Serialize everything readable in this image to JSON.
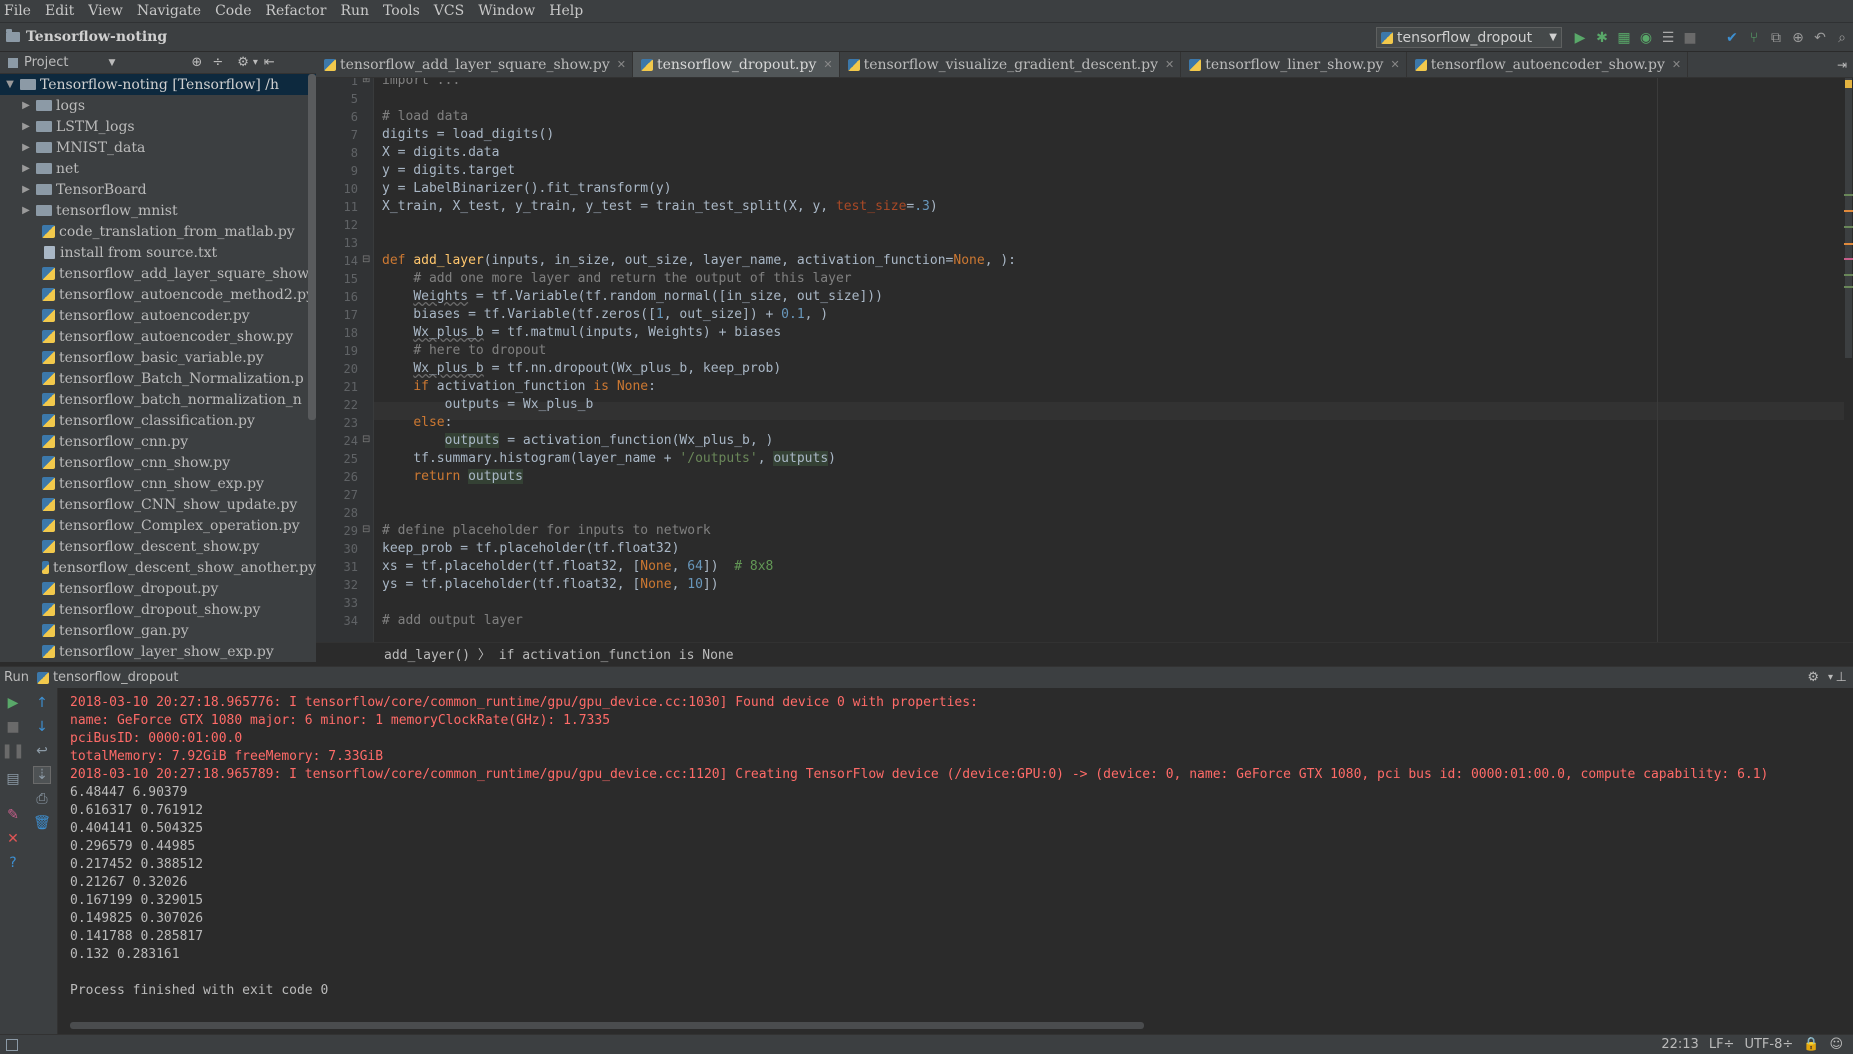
{
  "menu": [
    "File",
    "Edit",
    "View",
    "Navigate",
    "Code",
    "Refactor",
    "Run",
    "Tools",
    "VCS",
    "Window",
    "Help"
  ],
  "project_name": "Tensorflow-noting",
  "run_config": "tensorflow_dropout",
  "project_panel": {
    "title": "Project",
    "root_label": "Tensorflow-noting [Tensorflow] /h",
    "folders": [
      "logs",
      "LSTM_logs",
      "MNIST_data",
      "net",
      "TensorBoard",
      "tensorflow_mnist"
    ],
    "files": [
      {
        "name": "code_translation_from_matlab.py",
        "type": "py"
      },
      {
        "name": "install from source.txt",
        "type": "txt"
      },
      {
        "name": "tensorflow_add_layer_square_show",
        "type": "py"
      },
      {
        "name": "tensorflow_autoencode_method2.py",
        "type": "py"
      },
      {
        "name": "tensorflow_autoencoder.py",
        "type": "py"
      },
      {
        "name": "tensorflow_autoencoder_show.py",
        "type": "py"
      },
      {
        "name": "tensorflow_basic_variable.py",
        "type": "py"
      },
      {
        "name": "tensorflow_Batch_Normalization.p",
        "type": "py"
      },
      {
        "name": "tensorflow_batch_normalization_n",
        "type": "py"
      },
      {
        "name": "tensorflow_classification.py",
        "type": "py"
      },
      {
        "name": "tensorflow_cnn.py",
        "type": "py"
      },
      {
        "name": "tensorflow_cnn_show.py",
        "type": "py"
      },
      {
        "name": "tensorflow_cnn_show_exp.py",
        "type": "py"
      },
      {
        "name": "tensorflow_CNN_show_update.py",
        "type": "py"
      },
      {
        "name": "tensorflow_Complex_operation.py",
        "type": "py"
      },
      {
        "name": "tensorflow_descent_show.py",
        "type": "py"
      },
      {
        "name": "tensorflow_descent_show_another.py",
        "type": "py"
      },
      {
        "name": "tensorflow_dropout.py",
        "type": "py"
      },
      {
        "name": "tensorflow_dropout_show.py",
        "type": "py"
      },
      {
        "name": "tensorflow_gan.py",
        "type": "py"
      },
      {
        "name": "tensorflow_layer_show_exp.py",
        "type": "py"
      }
    ]
  },
  "editor_tabs": [
    {
      "label": "tensorflow_add_layer_square_show.py",
      "active": false
    },
    {
      "label": "tensorflow_dropout.py",
      "active": true
    },
    {
      "label": "tensorflow_visualize_gradient_descent.py",
      "active": false
    },
    {
      "label": "tensorflow_liner_show.py",
      "active": false
    },
    {
      "label": "tensorflow_autoencoder_show.py",
      "active": false
    }
  ],
  "code": [
    {
      "n": "1",
      "html": "<span class=\"cm2\">import ...</span>"
    },
    {
      "n": "5",
      "html": ""
    },
    {
      "n": "6",
      "html": "<span class=\"cm2\"># load data</span>"
    },
    {
      "n": "7",
      "html": "digits = load_digits()"
    },
    {
      "n": "8",
      "html": "X = digits.data"
    },
    {
      "n": "9",
      "html": "y = digits.target"
    },
    {
      "n": "10",
      "html": "y = LabelBinarizer().fit_transform(y)"
    },
    {
      "n": "11",
      "html": "X_train, X_test, y_train, y_test = train_test_split(X, y, <span class=\"param\">test_size</span>=<span class=\"num\">.3</span>)"
    },
    {
      "n": "12",
      "html": ""
    },
    {
      "n": "13",
      "html": ""
    },
    {
      "n": "14",
      "html": "<span class=\"kw\">def </span><span class=\"fn\">add_layer</span>(inputs, in_size, out_size, layer_name, activation_function=<span class=\"kw\">None</span>, ):"
    },
    {
      "n": "15",
      "html": "    <span class=\"cm2\"># add one more layer and return the output of this layer</span>"
    },
    {
      "n": "16",
      "html": "    <span class=\"under\">Weights</span> = tf.Variable(tf.random_normal([in_size, out_size]))"
    },
    {
      "n": "17",
      "html": "    biases = tf.Variable(tf.zeros([<span class=\"num\">1</span>, out_size]) + <span class=\"num\">0.1</span>, )"
    },
    {
      "n": "18",
      "html": "    <span class=\"under\">Wx_plus_b</span> = tf.matmul(inputs, Weights) + biases"
    },
    {
      "n": "19",
      "html": "    <span class=\"cm2\"># here to dropout</span>"
    },
    {
      "n": "20",
      "html": "    <span class=\"under\">Wx_plus_b</span> = tf.nn.dropout(Wx_plus_b, keep_prob)"
    },
    {
      "n": "21",
      "html": "    <span class=\"kw\">if </span>activation_function <span class=\"kw\">is None</span>:"
    },
    {
      "n": "22",
      "html": "        outputs = Wx_plus_b"
    },
    {
      "n": "23",
      "html": "    <span class=\"kw\">else</span>:"
    },
    {
      "n": "24",
      "html": "        <span class=\"hl\">outputs</span> = activation_function(Wx_plus_b, )"
    },
    {
      "n": "25",
      "html": "    tf.summary.histogram(layer_name + <span class=\"str\">'/outputs'</span>, <span class=\"hl\">outputs</span>)"
    },
    {
      "n": "26",
      "html": "    <span class=\"kw\">return </span><span class=\"hl\">outputs</span>"
    },
    {
      "n": "27",
      "html": ""
    },
    {
      "n": "28",
      "html": ""
    },
    {
      "n": "29",
      "html": "<span class=\"cm2\"># define placeholder for inputs to network</span>"
    },
    {
      "n": "30",
      "html": "keep_prob = tf.placeholder(tf.float32)"
    },
    {
      "n": "31",
      "html": "xs = tf.placeholder(tf.float32, [<span class=\"kw\">None</span>, <span class=\"num\">64</span>])  <span class=\"cm\"># 8x8</span>"
    },
    {
      "n": "32",
      "html": "ys = tf.placeholder(tf.float32, [<span class=\"kw\">None</span>, <span class=\"num\">10</span>])"
    },
    {
      "n": "33",
      "html": ""
    },
    {
      "n": "34",
      "html": "<span class=\"cm2\"># add output layer</span>"
    }
  ],
  "editor_breadcrumb": "add_layer()  〉 if activation_function is None",
  "run_panel": {
    "label": "Run",
    "config": "tensorflow_dropout"
  },
  "console": [
    {
      "type": "err",
      "text": "2018-03-10 20:27:18.965776: I tensorflow/core/common_runtime/gpu/gpu_device.cc:1030] Found device 0 with properties:"
    },
    {
      "type": "err",
      "text": "name: GeForce GTX 1080 major: 6 minor: 1 memoryClockRate(GHz): 1.7335"
    },
    {
      "type": "err",
      "text": "pciBusID: 0000:01:00.0"
    },
    {
      "type": "err",
      "text": "totalMemory: 7.92GiB freeMemory: 7.33GiB"
    },
    {
      "type": "err",
      "text": "2018-03-10 20:27:18.965789: I tensorflow/core/common_runtime/gpu/gpu_device.cc:1120] Creating TensorFlow device (/device:GPU:0) -> (device: 0, name: GeForce GTX 1080, pci bus id: 0000:01:00.0, compute capability: 6.1)"
    },
    {
      "type": "out",
      "text": "6.48447 6.90379"
    },
    {
      "type": "out",
      "text": "0.616317 0.761912"
    },
    {
      "type": "out",
      "text": "0.404141 0.504325"
    },
    {
      "type": "out",
      "text": "0.296579 0.44985"
    },
    {
      "type": "out",
      "text": "0.217452 0.388512"
    },
    {
      "type": "out",
      "text": "0.21267 0.32026"
    },
    {
      "type": "out",
      "text": "0.167199 0.329015"
    },
    {
      "type": "out",
      "text": "0.149825 0.307026"
    },
    {
      "type": "out",
      "text": "0.141788 0.285817"
    },
    {
      "type": "out",
      "text": "0.132 0.283161"
    },
    {
      "type": "out",
      "text": ""
    },
    {
      "type": "out",
      "text": "Process finished with exit code 0"
    }
  ],
  "status": {
    "position": "22:13",
    "line_sep": "LF÷",
    "encoding": "UTF-8÷"
  }
}
